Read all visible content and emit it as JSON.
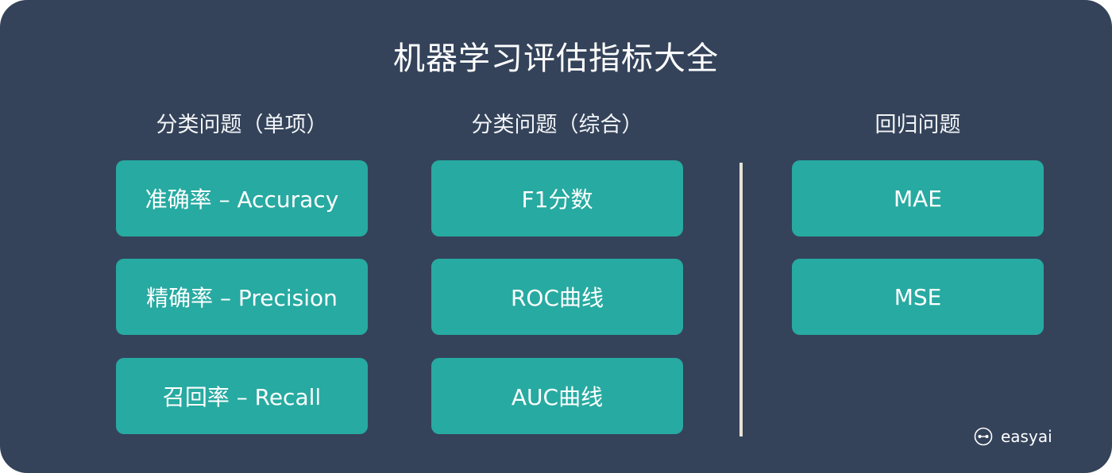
{
  "title": "机器学习评估指标大全",
  "columns": [
    {
      "header": "分类问题（单项）",
      "items": [
        "准确率 – Accuracy",
        "精确率 – Precision",
        "召回率 – Recall"
      ]
    },
    {
      "header": "分类问题（综合）",
      "items": [
        "F1分数",
        "ROC曲线",
        "AUC曲线"
      ]
    },
    {
      "header": "回归问题",
      "items": [
        "MAE",
        "MSE"
      ]
    }
  ],
  "brand": {
    "name": "easyai",
    "icon": "easyai-logo-icon"
  },
  "colors": {
    "background": "#34435a",
    "card": "#27aaa1",
    "divider": "#e7e2d6",
    "text": "#ffffff"
  }
}
